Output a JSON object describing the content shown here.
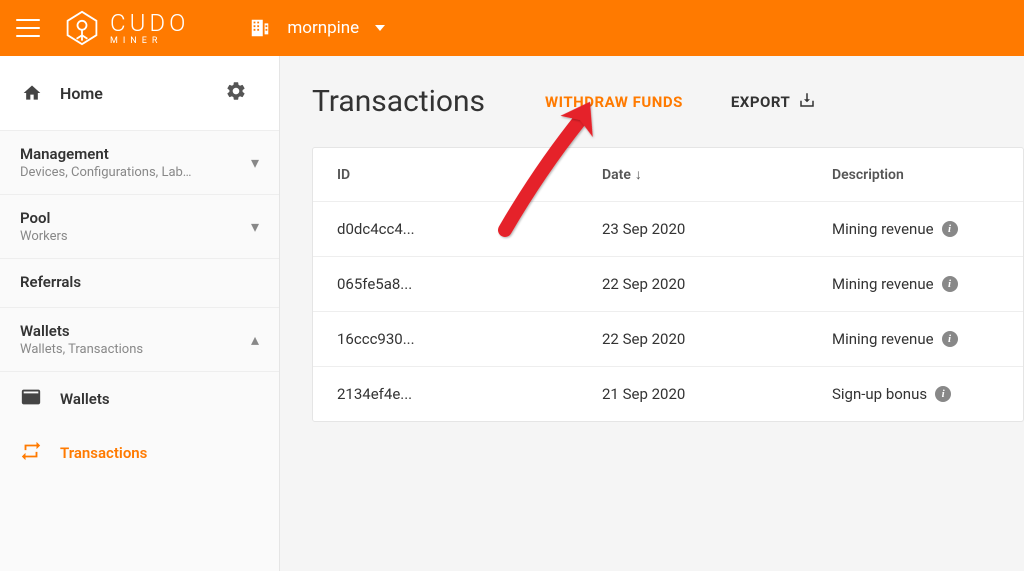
{
  "brand": {
    "name": "CUDO",
    "sub": "MINER"
  },
  "org": {
    "name": "mornpine"
  },
  "nav": {
    "home": "Home",
    "management": {
      "title": "Management",
      "sub": "Devices, Configurations, Lab…"
    },
    "pool": {
      "title": "Pool",
      "sub": "Workers"
    },
    "referrals": {
      "title": "Referrals"
    },
    "wallets_section": {
      "title": "Wallets",
      "sub": "Wallets, Transactions"
    },
    "wallets_item": "Wallets",
    "transactions_item": "Transactions"
  },
  "page": {
    "title": "Transactions",
    "withdraw": "WITHDRAW FUNDS",
    "export": "EXPORT"
  },
  "table": {
    "headers": {
      "id": "ID",
      "date": "Date",
      "desc": "Description"
    },
    "rows": [
      {
        "id": "d0dc4cc4...",
        "date": "23 Sep 2020",
        "desc": "Mining revenue",
        "info": true
      },
      {
        "id": "065fe5a8...",
        "date": "22 Sep 2020",
        "desc": "Mining revenue",
        "info": true
      },
      {
        "id": "16ccc930...",
        "date": "22 Sep 2020",
        "desc": "Mining revenue",
        "info": true
      },
      {
        "id": "2134ef4e...",
        "date": "21 Sep 2020",
        "desc": "Sign-up bonus",
        "info": true
      }
    ]
  }
}
